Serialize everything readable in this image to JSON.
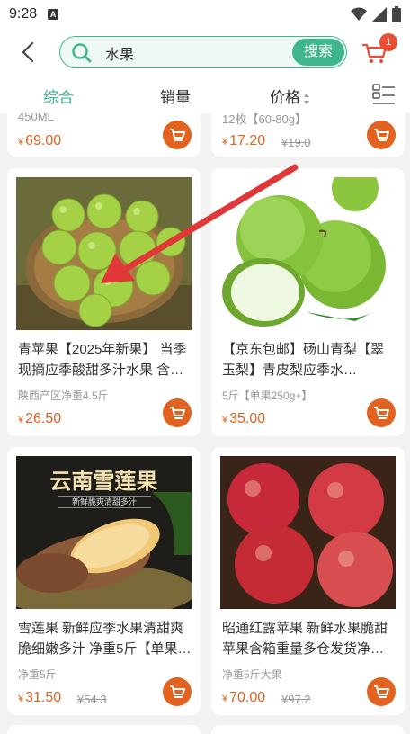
{
  "status_bar": {
    "time": "9:28",
    "sim_icon": "A"
  },
  "search": {
    "query": "水果",
    "button_label": "搜索"
  },
  "cart": {
    "badge_count": "1"
  },
  "tabs": [
    {
      "label": "综合",
      "active": true
    },
    {
      "label": "销量",
      "active": false
    },
    {
      "label": "价格",
      "active": false
    }
  ],
  "partial_row": [
    {
      "spec": "450ML",
      "price": "69.00",
      "original_price": ""
    },
    {
      "spec": "12枚【60-80g】",
      "price": "17.20",
      "original_price": "19.0"
    }
  ],
  "products": [
    {
      "title": "青苹果【2025年新果】 当季现摘应季酸甜多汁水果 含…",
      "spec": "陕西产区净重4.5斤",
      "price": "26.50",
      "original_price": ""
    },
    {
      "title": "【京东包邮】砀山青梨【翠玉梨】青皮梨应季水…",
      "spec": "5斤【单果250g+】",
      "price": "35.00",
      "original_price": ""
    },
    {
      "title": "雪莲果 新鲜应季水果清甜爽脆细嫩多汁 净重5斤【单果…",
      "spec": "净重5斤",
      "price": "31.50",
      "original_price": "54.3",
      "image_text": "云南雪莲果",
      "image_subtext": "新鲜脆爽清甜多汁"
    },
    {
      "title": "昭通红露苹果 新鲜水果脆甜苹果含箱重量多仓发货净…",
      "spec": "净重5斤大果",
      "price": "70.00",
      "original_price": "97.2"
    }
  ],
  "currency": "¥",
  "colors": {
    "accent": "#3fb68b",
    "price": "#e2621f",
    "badge": "#e94d35",
    "arrow": "#e03838"
  }
}
